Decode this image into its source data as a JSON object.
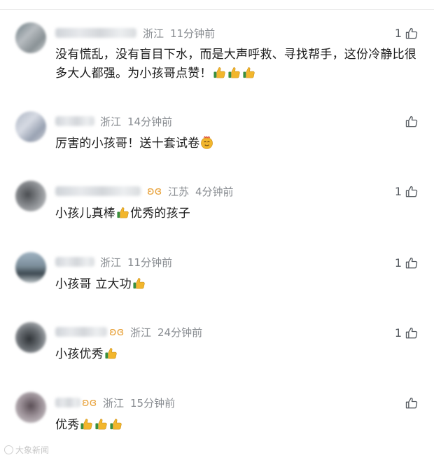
{
  "comments": [
    {
      "region": "浙江",
      "time": "11分钟前",
      "likes": "1",
      "text_main": "没有慌乱，没有盲目下水，而是大声呼救、寻找帮手，这份冷静比很多大人都强。为小孩哥点赞！",
      "emojis": [
        "thumbs-up-icon",
        "thumbs-up-icon",
        "thumbs-up-icon"
      ]
    },
    {
      "region": "浙江",
      "time": "14分钟前",
      "likes": "",
      "text_main": "厉害的小孩哥！送十套试卷",
      "emojis": [
        "cheeky-face-icon"
      ]
    },
    {
      "region": "江苏",
      "time": "4分钟前",
      "likes": "1",
      "text_main": "小孩儿真棒",
      "text_after": "优秀的孩子",
      "emojis": [
        "thumbs-up-icon"
      ]
    },
    {
      "region": "浙江",
      "time": "11分钟前",
      "likes": "1",
      "text_main": "小孩哥 立大功",
      "emojis": [
        "thumbs-up-icon"
      ]
    },
    {
      "region": "浙江",
      "time": "24分钟前",
      "likes": "1",
      "text_main": "小孩优秀",
      "emojis": [
        "thumbs-up-icon"
      ]
    },
    {
      "region": "浙江",
      "time": "15分钟前",
      "likes": "",
      "text_main": "优秀",
      "emojis": [
        "thumbs-up-icon",
        "thumbs-up-icon",
        "thumbs-up-icon"
      ]
    }
  ],
  "watermark": "大象新闻",
  "colors": {
    "meta": "#888c91",
    "vip": "#e8a33d",
    "emoji": "#f2b62c"
  }
}
